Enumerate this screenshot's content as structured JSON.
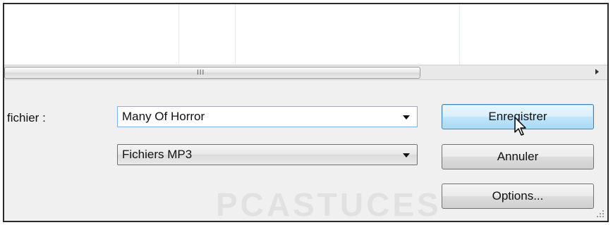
{
  "file_field": {
    "label": "fichier :",
    "value": "Many Of Horror"
  },
  "type_field": {
    "value": "Fichiers MP3"
  },
  "buttons": {
    "save": "Enregistrer",
    "cancel": "Annuler",
    "options": "Options..."
  },
  "scrollbar": {
    "grip": "III"
  },
  "watermark": "PCASTUCES",
  "colors": {
    "default_button": "#bee6fd",
    "focus_border": "#7eb4ea"
  }
}
